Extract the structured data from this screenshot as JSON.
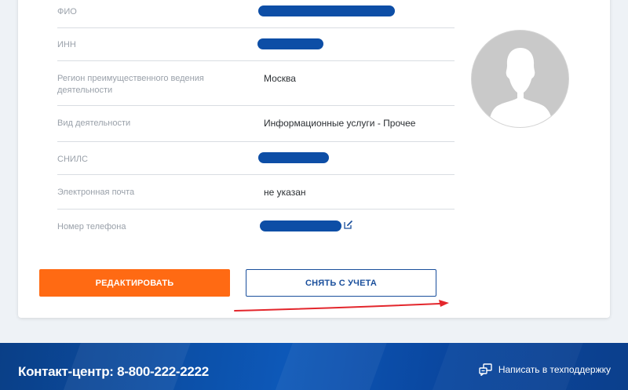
{
  "profile": {
    "rows": [
      {
        "label": "ФИО",
        "value": null,
        "redacted": true
      },
      {
        "label": "ИНН",
        "value": null,
        "redacted": true
      },
      {
        "label": "Регион преимущественного ведения деятельности",
        "value": "Москва",
        "redacted": false
      },
      {
        "label": "Вид деятельности",
        "value": "Информационные услуги - Прочее",
        "redacted": false
      },
      {
        "label": "СНИЛС",
        "value": null,
        "redacted": true
      },
      {
        "label": "Электронная почта",
        "value": "не указан",
        "redacted": false
      },
      {
        "label": "Номер телефона",
        "value": null,
        "redacted": true,
        "editable": true
      }
    ],
    "avatar_icon": "user-silhouette-icon"
  },
  "actions": {
    "edit_label": "РЕДАКТИРОВАТЬ",
    "deregister_label": "СНЯТЬ С УЧЕТА"
  },
  "footer": {
    "contact": "Контакт-центр: 8-800-222-2222",
    "support_label": "Написать в техподдержку",
    "support_icon": "chat-icon"
  },
  "colors": {
    "primary_button": "#ff6a13",
    "secondary_button_border": "#1a4f9c",
    "redaction": "#0d4ea6",
    "annotation_arrow": "#e3262c",
    "footer_bg": "#0d58b8"
  }
}
